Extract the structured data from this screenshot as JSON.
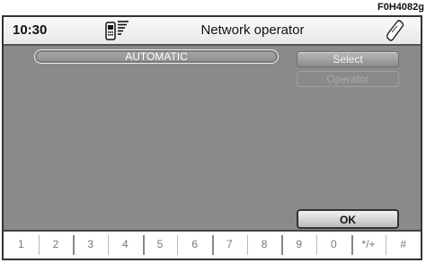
{
  "figure_code": "F0H4082g",
  "header": {
    "time": "10:30",
    "title": "Network operator",
    "signal_icon": "phone-signal-icon",
    "phone_icon": "mobile-phone-icon"
  },
  "content": {
    "operator_mode": "AUTOMATIC",
    "select_label": "Select",
    "operator_label": "Operator",
    "ok_label": "OK"
  },
  "keypad": {
    "keys": [
      "1",
      "2",
      "3",
      "4",
      "5",
      "6",
      "7",
      "8",
      "9",
      "0",
      "*/+",
      "#"
    ]
  }
}
